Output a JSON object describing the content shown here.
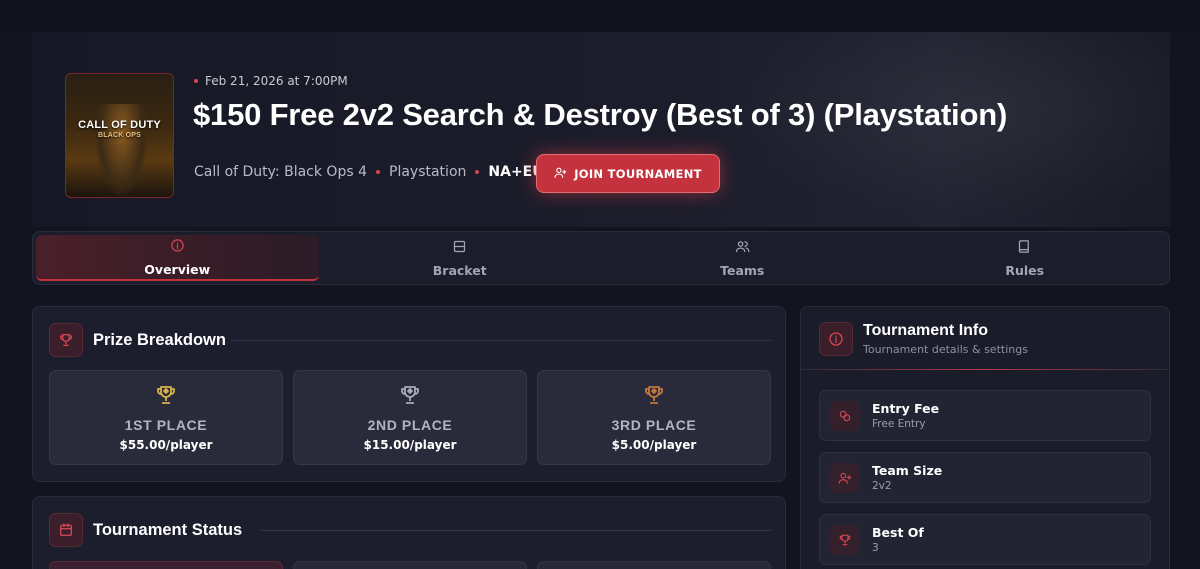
{
  "header": {
    "date": "Feb 21, 2026 at 7:00PM",
    "title": "$150 Free 2v2 Search & Destroy (Best of 3) (Playstation)",
    "game": "Call of Duty: Black Ops 4",
    "platform": "Playstation",
    "region": "NA+EU",
    "join_label": "JOIN TOURNAMENT",
    "cover_logo": "CALL OF DUTY",
    "cover_sub": "BLACK OPS"
  },
  "tabs": [
    {
      "label": "Overview",
      "icon": "info-icon",
      "active": true
    },
    {
      "label": "Bracket",
      "icon": "bracket-icon",
      "active": false
    },
    {
      "label": "Teams",
      "icon": "users-icon",
      "active": false
    },
    {
      "label": "Rules",
      "icon": "book-icon",
      "active": false
    }
  ],
  "prize": {
    "title": "Prize Breakdown",
    "places": [
      {
        "name": "1ST PLACE",
        "amount": "$55.00/player",
        "color": "#d8b24a"
      },
      {
        "name": "2ND PLACE",
        "amount": "$15.00/player",
        "color": "#a9aab6"
      },
      {
        "name": "3RD PLACE",
        "amount": "$5.00/player",
        "color": "#c4773d"
      }
    ]
  },
  "status": {
    "title": "Tournament Status"
  },
  "info": {
    "title": "Tournament Info",
    "subtitle": "Tournament details & settings",
    "items": [
      {
        "label": "Entry Fee",
        "value": "Free Entry",
        "icon": "coins-icon"
      },
      {
        "label": "Team Size",
        "value": "2v2",
        "icon": "user-plus-icon"
      },
      {
        "label": "Best Of",
        "value": "3",
        "icon": "trophy-icon"
      }
    ]
  },
  "colors": {
    "accent": "#c4323e",
    "background": "#131420",
    "card": "#1d1e2d"
  }
}
